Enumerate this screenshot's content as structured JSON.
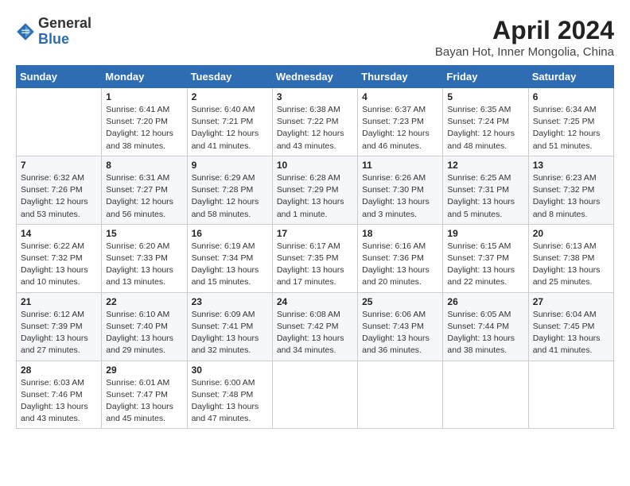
{
  "logo": {
    "general": "General",
    "blue": "Blue"
  },
  "title": "April 2024",
  "subtitle": "Bayan Hot, Inner Mongolia, China",
  "days_header": [
    "Sunday",
    "Monday",
    "Tuesday",
    "Wednesday",
    "Thursday",
    "Friday",
    "Saturday"
  ],
  "weeks": [
    [
      {
        "day": "",
        "info": ""
      },
      {
        "day": "1",
        "info": "Sunrise: 6:41 AM\nSunset: 7:20 PM\nDaylight: 12 hours\nand 38 minutes."
      },
      {
        "day": "2",
        "info": "Sunrise: 6:40 AM\nSunset: 7:21 PM\nDaylight: 12 hours\nand 41 minutes."
      },
      {
        "day": "3",
        "info": "Sunrise: 6:38 AM\nSunset: 7:22 PM\nDaylight: 12 hours\nand 43 minutes."
      },
      {
        "day": "4",
        "info": "Sunrise: 6:37 AM\nSunset: 7:23 PM\nDaylight: 12 hours\nand 46 minutes."
      },
      {
        "day": "5",
        "info": "Sunrise: 6:35 AM\nSunset: 7:24 PM\nDaylight: 12 hours\nand 48 minutes."
      },
      {
        "day": "6",
        "info": "Sunrise: 6:34 AM\nSunset: 7:25 PM\nDaylight: 12 hours\nand 51 minutes."
      }
    ],
    [
      {
        "day": "7",
        "info": "Sunrise: 6:32 AM\nSunset: 7:26 PM\nDaylight: 12 hours\nand 53 minutes."
      },
      {
        "day": "8",
        "info": "Sunrise: 6:31 AM\nSunset: 7:27 PM\nDaylight: 12 hours\nand 56 minutes."
      },
      {
        "day": "9",
        "info": "Sunrise: 6:29 AM\nSunset: 7:28 PM\nDaylight: 12 hours\nand 58 minutes."
      },
      {
        "day": "10",
        "info": "Sunrise: 6:28 AM\nSunset: 7:29 PM\nDaylight: 13 hours\nand 1 minute."
      },
      {
        "day": "11",
        "info": "Sunrise: 6:26 AM\nSunset: 7:30 PM\nDaylight: 13 hours\nand 3 minutes."
      },
      {
        "day": "12",
        "info": "Sunrise: 6:25 AM\nSunset: 7:31 PM\nDaylight: 13 hours\nand 5 minutes."
      },
      {
        "day": "13",
        "info": "Sunrise: 6:23 AM\nSunset: 7:32 PM\nDaylight: 13 hours\nand 8 minutes."
      }
    ],
    [
      {
        "day": "14",
        "info": "Sunrise: 6:22 AM\nSunset: 7:32 PM\nDaylight: 13 hours\nand 10 minutes."
      },
      {
        "day": "15",
        "info": "Sunrise: 6:20 AM\nSunset: 7:33 PM\nDaylight: 13 hours\nand 13 minutes."
      },
      {
        "day": "16",
        "info": "Sunrise: 6:19 AM\nSunset: 7:34 PM\nDaylight: 13 hours\nand 15 minutes."
      },
      {
        "day": "17",
        "info": "Sunrise: 6:17 AM\nSunset: 7:35 PM\nDaylight: 13 hours\nand 17 minutes."
      },
      {
        "day": "18",
        "info": "Sunrise: 6:16 AM\nSunset: 7:36 PM\nDaylight: 13 hours\nand 20 minutes."
      },
      {
        "day": "19",
        "info": "Sunrise: 6:15 AM\nSunset: 7:37 PM\nDaylight: 13 hours\nand 22 minutes."
      },
      {
        "day": "20",
        "info": "Sunrise: 6:13 AM\nSunset: 7:38 PM\nDaylight: 13 hours\nand 25 minutes."
      }
    ],
    [
      {
        "day": "21",
        "info": "Sunrise: 6:12 AM\nSunset: 7:39 PM\nDaylight: 13 hours\nand 27 minutes."
      },
      {
        "day": "22",
        "info": "Sunrise: 6:10 AM\nSunset: 7:40 PM\nDaylight: 13 hours\nand 29 minutes."
      },
      {
        "day": "23",
        "info": "Sunrise: 6:09 AM\nSunset: 7:41 PM\nDaylight: 13 hours\nand 32 minutes."
      },
      {
        "day": "24",
        "info": "Sunrise: 6:08 AM\nSunset: 7:42 PM\nDaylight: 13 hours\nand 34 minutes."
      },
      {
        "day": "25",
        "info": "Sunrise: 6:06 AM\nSunset: 7:43 PM\nDaylight: 13 hours\nand 36 minutes."
      },
      {
        "day": "26",
        "info": "Sunrise: 6:05 AM\nSunset: 7:44 PM\nDaylight: 13 hours\nand 38 minutes."
      },
      {
        "day": "27",
        "info": "Sunrise: 6:04 AM\nSunset: 7:45 PM\nDaylight: 13 hours\nand 41 minutes."
      }
    ],
    [
      {
        "day": "28",
        "info": "Sunrise: 6:03 AM\nSunset: 7:46 PM\nDaylight: 13 hours\nand 43 minutes."
      },
      {
        "day": "29",
        "info": "Sunrise: 6:01 AM\nSunset: 7:47 PM\nDaylight: 13 hours\nand 45 minutes."
      },
      {
        "day": "30",
        "info": "Sunrise: 6:00 AM\nSunset: 7:48 PM\nDaylight: 13 hours\nand 47 minutes."
      },
      {
        "day": "",
        "info": ""
      },
      {
        "day": "",
        "info": ""
      },
      {
        "day": "",
        "info": ""
      },
      {
        "day": "",
        "info": ""
      }
    ]
  ]
}
